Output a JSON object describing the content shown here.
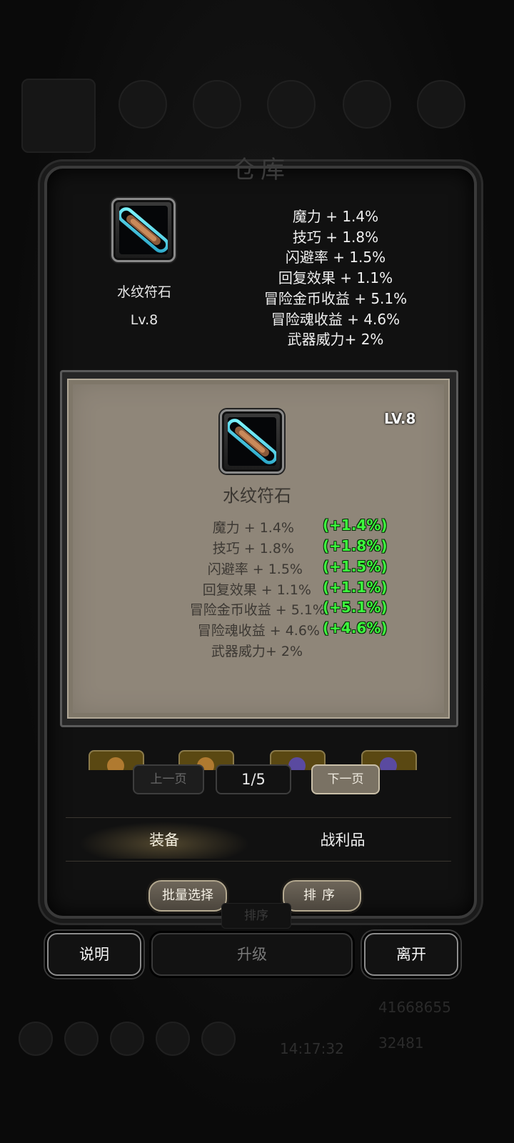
{
  "window": {
    "title": "仓库"
  },
  "background": {
    "gold_value": "41668655",
    "gem_value": "32481",
    "time": "14:17:32"
  },
  "item_summary": {
    "name": "水纹符石",
    "level": "Lv.8",
    "stats": [
      "魔力 + 1.4%",
      "技巧 + 1.8%",
      "闪避率 + 1.5%",
      "回复效果 + 1.1%",
      "冒险金币收益 + 5.1%",
      "冒险魂收益 + 4.6%",
      "武器威力+ 2%"
    ]
  },
  "item_detail": {
    "level": "LV.8",
    "name": "水纹符石",
    "stats": [
      {
        "text": "魔力 + 1.4%",
        "bonus": "(+1.4%)"
      },
      {
        "text": "技巧 + 1.8%",
        "bonus": "(+1.8%)"
      },
      {
        "text": "闪避率 + 1.5%",
        "bonus": "(+1.5%)"
      },
      {
        "text": "回复效果 + 1.1%",
        "bonus": "(+1.1%)"
      },
      {
        "text": "冒险金币收益 + 5.1%",
        "bonus": "(+5.1%)"
      },
      {
        "text": "冒险魂收益 + 4.6%",
        "bonus": "(+4.6%)"
      },
      {
        "text": "武器威力+ 2%",
        "bonus": ""
      }
    ],
    "icon": "rune-stone-icon"
  },
  "pagination": {
    "prev_label": "上一页",
    "indicator": "1/5",
    "next_label": "下一页"
  },
  "tabs": [
    {
      "label": "装备",
      "active": true
    },
    {
      "label": "战利品",
      "active": false
    }
  ],
  "actions": {
    "batch_select": "批量选择",
    "sort": "排序",
    "sort_ghost": "排序",
    "help": "说明",
    "upgrade": "升级",
    "leave": "离开"
  },
  "colors": {
    "bonus_green": "#3dfa3d",
    "parchment": "#8f8679",
    "frame": "#3a3a3a"
  }
}
